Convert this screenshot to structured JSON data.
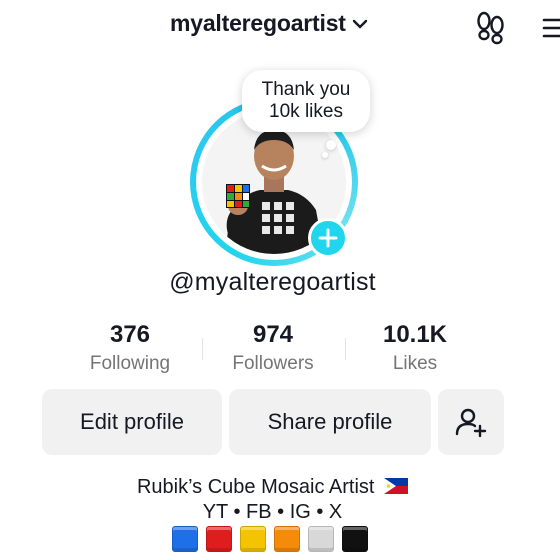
{
  "header": {
    "username": "myalteregoartist",
    "dropdown_icon": "chevron-down-icon",
    "footprint_icon": "footprints-icon",
    "menu_icon": "hamburger-menu-icon"
  },
  "avatar": {
    "note_line1": "Thank you",
    "note_line2": "10k likes",
    "ring_color": "#20d5ec",
    "add_icon": "plus-icon"
  },
  "profile": {
    "handle": "@myalteregoartist"
  },
  "stats": [
    {
      "value": "376",
      "label": "Following"
    },
    {
      "value": "974",
      "label": "Followers"
    },
    {
      "value": "10.1K",
      "label": "Likes"
    }
  ],
  "actions": {
    "edit_label": "Edit profile",
    "share_label": "Share profile",
    "add_friend_icon": "add-friend-icon"
  },
  "bio": {
    "line1": "Rubik’s Cube Mosaic Artist",
    "flag_icon": "philippines-flag-icon",
    "line2": "YT • FB • IG • X",
    "cube_colors": [
      "#1f6fe8",
      "#e01d1d",
      "#f5c400",
      "#f58a0b",
      "#d8d8d8",
      "#111111"
    ]
  }
}
